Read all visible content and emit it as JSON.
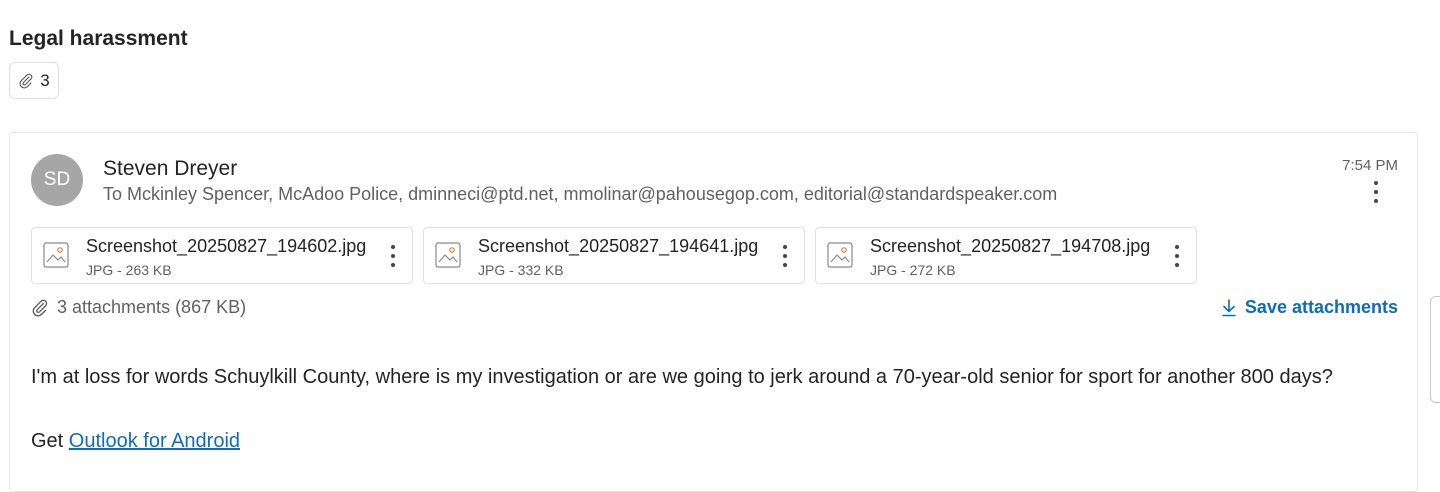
{
  "subject": "Legal harassment",
  "attachment_chip": {
    "icon": "paperclip-icon",
    "count": "3"
  },
  "message": {
    "avatar_initials": "SD",
    "sender": "Steven Dreyer",
    "recipients": "To Mckinley Spencer, McAdoo Police, dminneci@ptd.net, mmolinar@pahousegop.com, editorial@standardspeaker.com",
    "time": "7:54 PM",
    "attachments": [
      {
        "name": "Screenshot_20250827_194602.jpg",
        "meta": "JPG - 263 KB"
      },
      {
        "name": "Screenshot_20250827_194641.jpg",
        "meta": "JPG - 332 KB"
      },
      {
        "name": "Screenshot_20250827_194708.jpg",
        "meta": "JPG - 272 KB"
      }
    ],
    "attachments_summary": "3 attachments (867 KB)",
    "save_attachments_label": "Save attachments",
    "body": "I'm at loss for words Schuylkill County, where is my investigation or are we going to jerk around a 70-year-old senior for sport for another 800 days?",
    "signature_prefix": "Get ",
    "signature_link": "Outlook for Android"
  },
  "colors": {
    "accent": "#0f6cbd",
    "avatar_bg": "#a6a6a6",
    "secondary_text": "#616161"
  }
}
